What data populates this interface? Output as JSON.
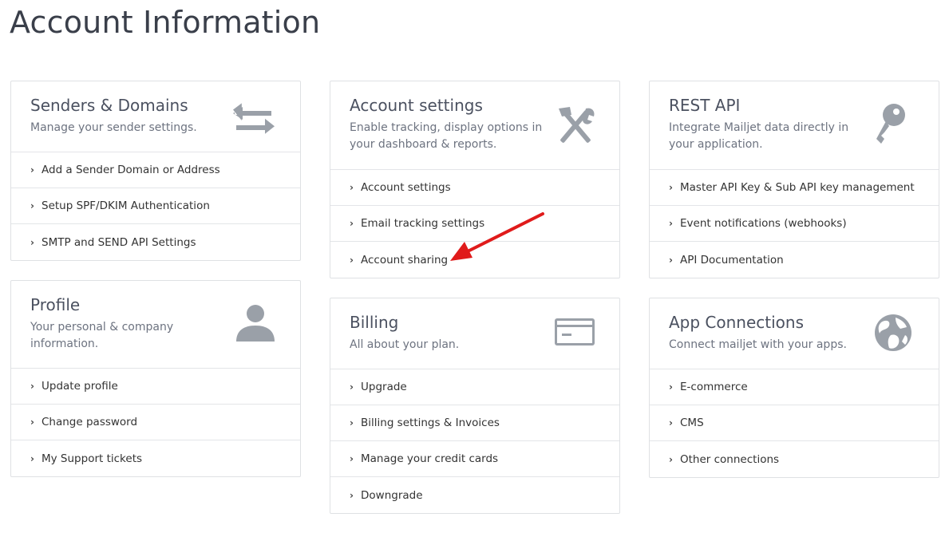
{
  "page": {
    "title": "Account Information"
  },
  "cards": {
    "senders": {
      "title": "Senders & Domains",
      "desc": "Manage your sender settings.",
      "icon": "swap-arrows-icon",
      "links": [
        "Add a Sender Domain or Address",
        "Setup SPF/DKIM Authentication",
        "SMTP and SEND API Settings"
      ]
    },
    "profile": {
      "title": "Profile",
      "desc": "Your personal & company information.",
      "icon": "user-icon",
      "links": [
        "Update profile",
        "Change password",
        "My Support tickets"
      ]
    },
    "account_settings": {
      "title": "Account settings",
      "desc": "Enable tracking, display options in your dashboard & reports.",
      "icon": "tools-icon",
      "links": [
        "Account settings",
        "Email tracking settings",
        "Account sharing"
      ]
    },
    "billing": {
      "title": "Billing",
      "desc": "All about your plan.",
      "icon": "credit-card-icon",
      "links": [
        "Upgrade",
        "Billing settings & Invoices",
        "Manage your credit cards",
        "Downgrade"
      ]
    },
    "rest_api": {
      "title": "REST API",
      "desc": "Integrate Mailjet data directly in your application.",
      "icon": "key-icon",
      "links": [
        "Master API Key & Sub API key management",
        "Event notifications (webhooks)",
        "API Documentation"
      ]
    },
    "app_connections": {
      "title": "App Connections",
      "desc": "Connect mailjet with your apps.",
      "icon": "globe-icon",
      "links": [
        "E-commerce",
        "CMS",
        "Other connections"
      ]
    }
  },
  "colors": {
    "icon": "#9aa0a8",
    "annotation_arrow": "#e01b1b",
    "border": "#dfe1e4"
  }
}
